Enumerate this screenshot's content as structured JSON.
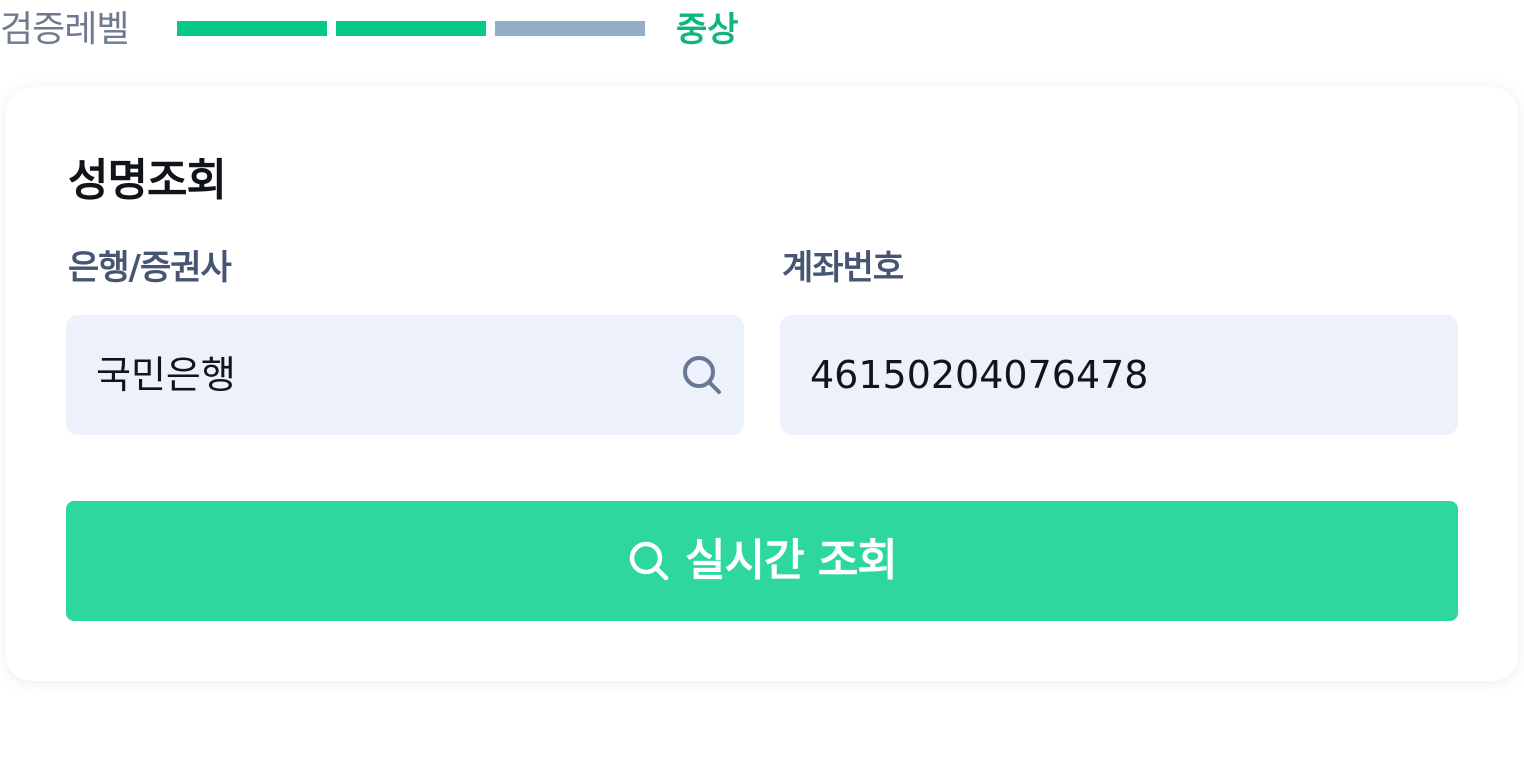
{
  "verification": {
    "label": "검증레벨",
    "level_text": "중상",
    "segments": [
      {
        "state": "filled"
      },
      {
        "state": "filled"
      },
      {
        "state": "empty"
      }
    ],
    "colors": {
      "filled": "#06c989",
      "empty": "#94aec8",
      "level_text": "#0fb57e"
    }
  },
  "card": {
    "title": "성명조회",
    "bank": {
      "label": "은행/증권사",
      "value": "국민은행",
      "icon": "search-icon"
    },
    "account": {
      "label": "계좌번호",
      "value": "46150204076478"
    },
    "submit": {
      "label": "실시간 조회",
      "icon": "search-icon",
      "color": "#2ed6a0"
    }
  }
}
